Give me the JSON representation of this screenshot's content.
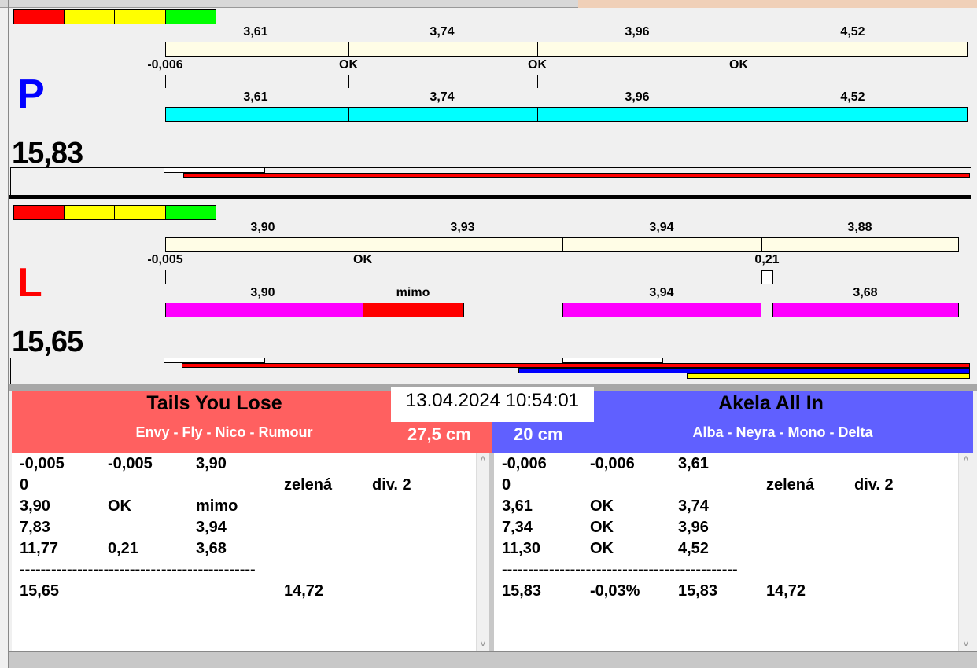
{
  "colors": {
    "red": "#ff0000",
    "yellow": "#ffff00",
    "green": "#00ff00",
    "cream": "#fffde6",
    "cyan": "#00ffff",
    "magenta": "#ff00ff",
    "left_team": "#ff6060",
    "right_team": "#6060ff"
  },
  "p_panel": {
    "letter": "P",
    "total": "15,83",
    "top_labels": [
      "3,61",
      "3,74",
      "3,96",
      "4,52"
    ],
    "mid_labels": [
      "-0,006",
      "OK",
      "OK",
      "OK"
    ],
    "bottom_labels": [
      "3,61",
      "3,74",
      "3,96",
      "4,52"
    ]
  },
  "l_panel": {
    "letter": "L",
    "total": "15,65",
    "top_labels": [
      "3,90",
      "3,93",
      "3,94",
      "3,88"
    ],
    "mid_labels": [
      "-0,005",
      "OK",
      "0,21"
    ],
    "bottom_labels": [
      "3,90",
      "mimo",
      "3,94",
      "3,68"
    ]
  },
  "datetime": "13.04.2024 10:54:01",
  "left_team": {
    "name": "Tails You Lose",
    "dogs": "Envy - Fly - Nico - Rumour",
    "distance": "27,5 cm",
    "rows": [
      [
        "-0,005",
        "-0,005",
        "3,90",
        "",
        ""
      ],
      [
        "0",
        "",
        "",
        "zelená",
        "div. 2"
      ],
      [
        "3,90",
        "OK",
        "mimo",
        "",
        ""
      ],
      [
        "7,83",
        "",
        "3,94",
        "",
        ""
      ],
      [
        "11,77",
        "0,21",
        "3,68",
        "",
        ""
      ],
      [
        "---------------------------------------------",
        "",
        "",
        "",
        ""
      ],
      [
        "15,65",
        "",
        "",
        "14,72",
        ""
      ]
    ]
  },
  "right_team": {
    "name": "Akela All In",
    "dogs": "Alba - Neyra - Mono - Delta",
    "distance": "20 cm",
    "rows": [
      [
        "-0,006",
        "-0,006",
        "3,61",
        "",
        ""
      ],
      [
        "0",
        "",
        "",
        "zelená",
        "div. 2"
      ],
      [
        "3,61",
        "OK",
        "3,74",
        "",
        ""
      ],
      [
        "7,34",
        "OK",
        "3,96",
        "",
        ""
      ],
      [
        "11,30",
        "OK",
        "4,52",
        "",
        ""
      ],
      [
        "---------------------------------------------",
        "",
        "",
        "",
        ""
      ],
      [
        "15,83",
        "-0,03%",
        "15,83",
        "14,72",
        ""
      ]
    ]
  }
}
